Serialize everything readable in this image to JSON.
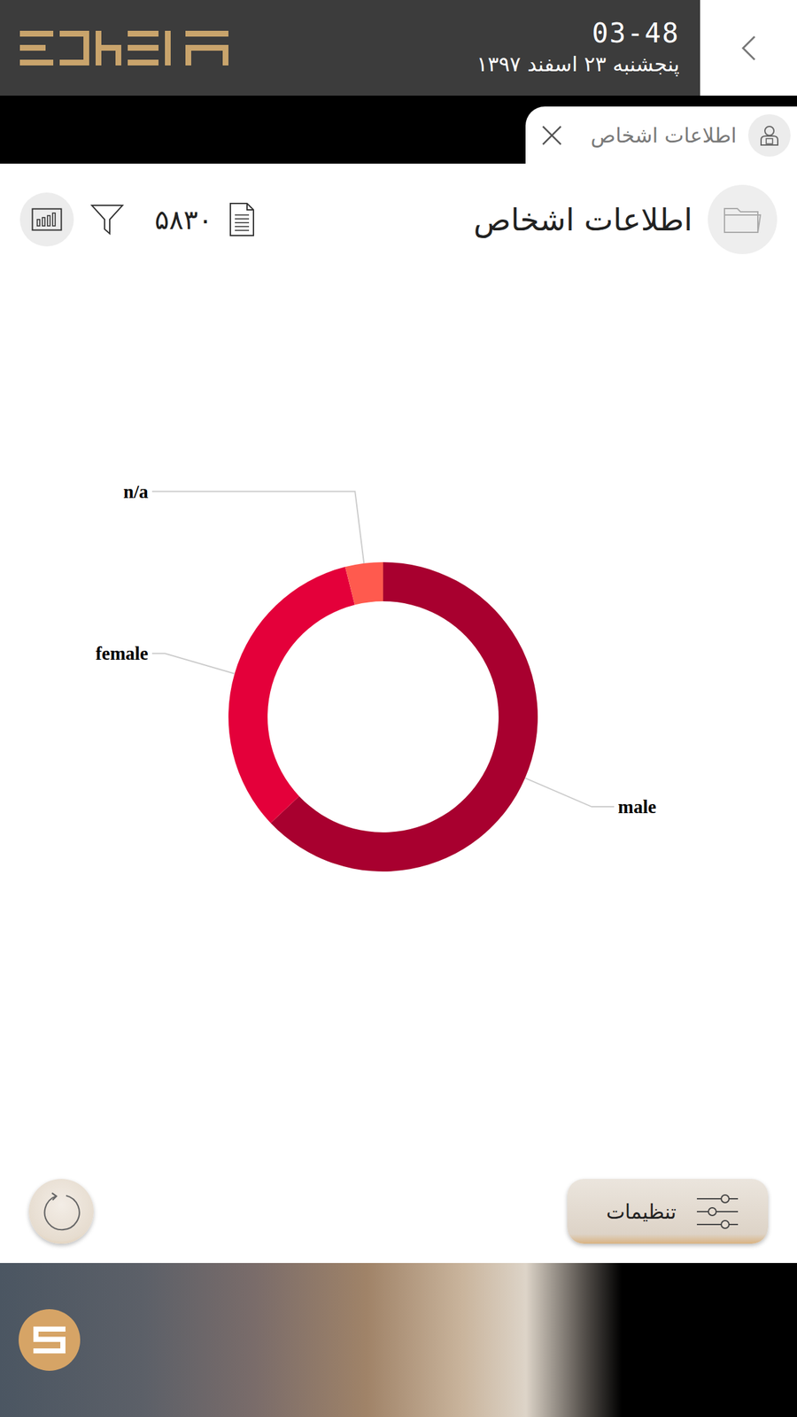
{
  "header": {
    "time": "03-48",
    "date": "پنجشنبه ۲۳ اسفند ۱۳۹۷"
  },
  "tabs": [
    {
      "label": "اطلاعات اشخاص",
      "selected": true
    }
  ],
  "page": {
    "title": "اطلاعات اشخاص",
    "count": "۵۸۳۰"
  },
  "chart": {
    "type": "donut",
    "slices": [
      {
        "label": "male",
        "value": 3670,
        "color": "#a8002f"
      },
      {
        "label": "female",
        "value": 1930,
        "color": "#e4003a"
      },
      {
        "label": "n/a",
        "value": 230,
        "color": "#ff5a4e"
      }
    ]
  },
  "buttons": {
    "settings": "تنظیمات"
  }
}
